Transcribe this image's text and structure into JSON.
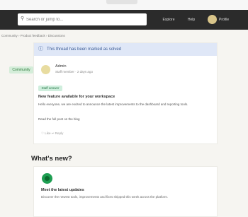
{
  "topbar": {
    "search_placeholder": "Search or jump to...",
    "nav": [
      "Explore",
      "Help"
    ],
    "user": "Profile"
  },
  "breadcrumb": "Community › Product feedback › Discussions",
  "post": {
    "notice": "This thread has been marked as solved",
    "author_badge": "Community",
    "author_name": "Admin",
    "author_meta": "Staff member · 2 days ago",
    "status": "Staff answer",
    "title": "New feature available for your workspace",
    "body": "Hello everyone, we are excited to announce the latest improvements to the dashboard and reporting tools.",
    "more": "Read the full post on the blog",
    "actions": "♡ Like   ↩ Reply"
  },
  "section": {
    "title": "What's new?"
  },
  "card2": {
    "title": "Meet the latest updates",
    "body": "Discover the newest tools, improvements and fixes shipped this week across the platform."
  }
}
